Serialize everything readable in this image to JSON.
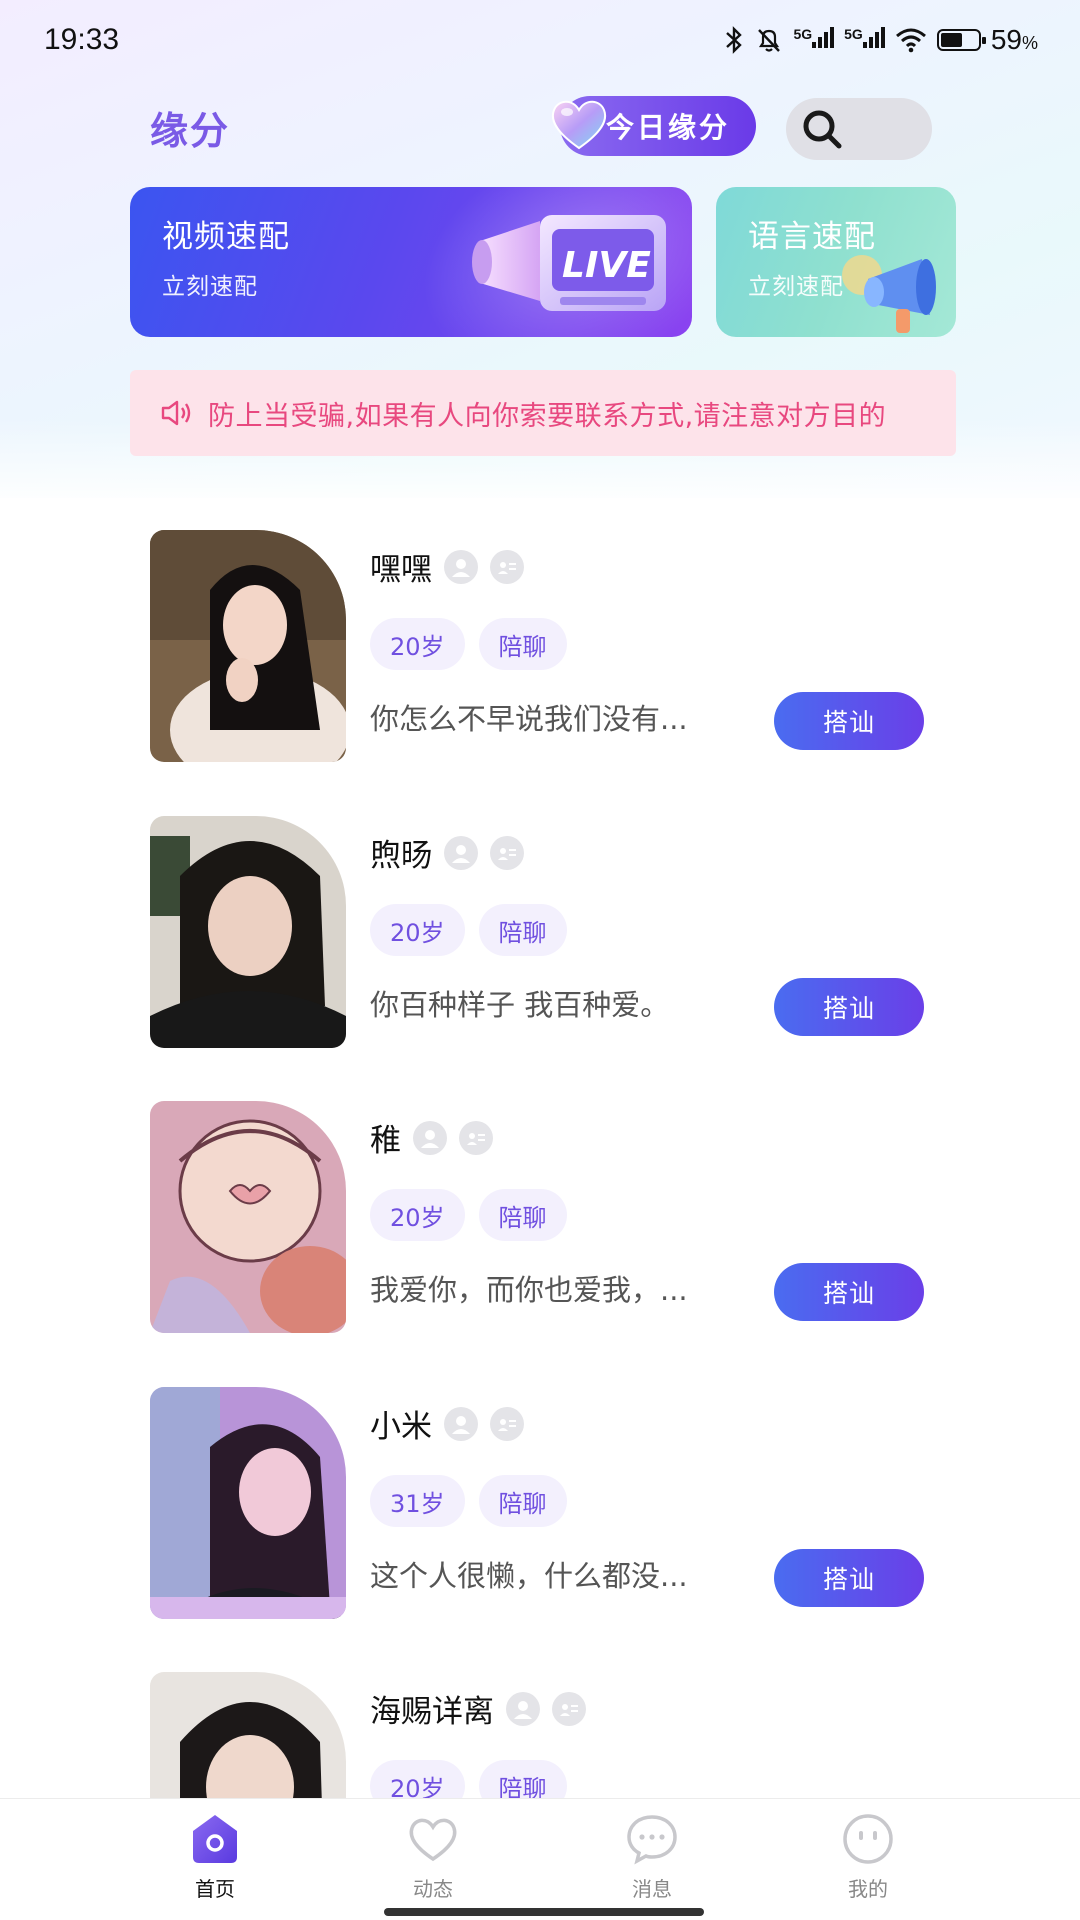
{
  "status_bar": {
    "time": "19:33",
    "network_1": "5G",
    "network_2": "5G",
    "battery_percent": "59",
    "battery_unit": "%",
    "battery_level": 0.59
  },
  "header": {
    "title": "缘分",
    "today_button": "今日缘分",
    "search_icon": "search-icon"
  },
  "match_cards": [
    {
      "title": "视频速配",
      "subtitle": "立刻速配"
    },
    {
      "title": "语言速配",
      "subtitle": "立刻速配"
    }
  ],
  "notice": {
    "text": "防上当受骗,如果有人向你索要联系方式,请注意对方目的",
    "icon": "speaker-icon"
  },
  "users": [
    {
      "name": "嘿嘿",
      "age": "20岁",
      "tag": "陪聊",
      "bio": "你怎么不早说我们没有...",
      "button": "搭讪"
    },
    {
      "name": "煦旸",
      "age": "20岁",
      "tag": "陪聊",
      "bio": "你百种样子 我百种爱。",
      "button": "搭讪"
    },
    {
      "name": "稚",
      "age": "20岁",
      "tag": "陪聊",
      "bio": "我爱你，而你也爱我，...",
      "button": "搭讪"
    },
    {
      "name": "小米",
      "age": "31岁",
      "tag": "陪聊",
      "bio": "这个人很懒，什么都没...",
      "button": "搭讪"
    },
    {
      "name": "海赐详离",
      "age": "20岁",
      "tag": "陪聊",
      "bio": "",
      "button": ""
    }
  ],
  "bottom_nav": [
    {
      "label": "首页",
      "icon": "home-icon",
      "active": true
    },
    {
      "label": "动态",
      "icon": "heart-icon",
      "active": false
    },
    {
      "label": "消息",
      "icon": "chat-icon",
      "active": false
    },
    {
      "label": "我的",
      "icon": "profile-icon",
      "active": false
    }
  ],
  "colors": {
    "accent": "#6a3fe8",
    "notice_text": "#e8487f",
    "tag_text": "#7050e0"
  }
}
